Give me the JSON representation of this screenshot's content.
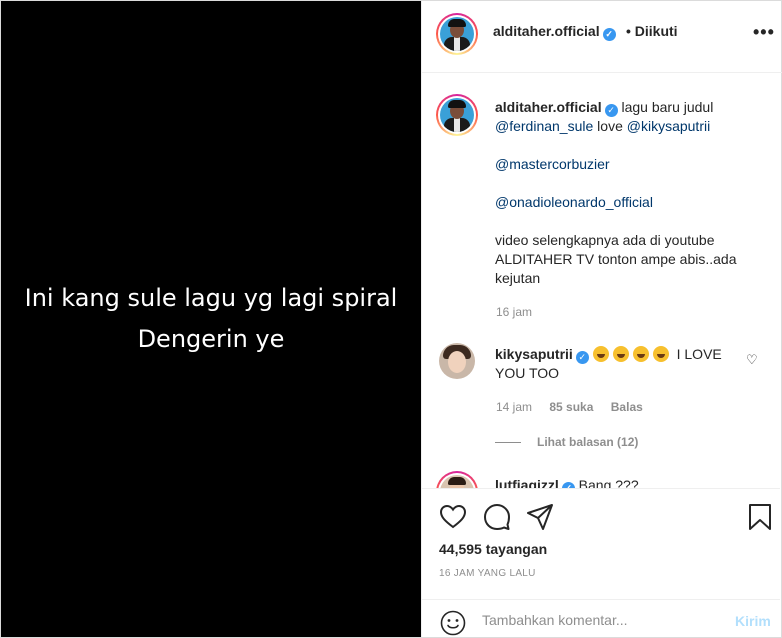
{
  "media": {
    "caption_lines": [
      "Ini kang sule lagu yg lagi spiral",
      "Dengerin ye"
    ]
  },
  "header": {
    "username": "alditaher.official",
    "follow_status": "• Diikuti",
    "more": "•••"
  },
  "caption": {
    "username": "alditaher.official",
    "text_line1": "lagu baru judul",
    "mention1": "@ferdinan_sule",
    "word_love": "love",
    "mention2": "@kikysaputrii",
    "mention3": "@mastercorbuzier",
    "mention4": "@onadioleonardo_official",
    "body": "video selengkapnya ada di youtube ALDITAHER TV tonton ampe abis..ada kejutan",
    "time": "16 jam"
  },
  "comments": [
    {
      "username": "kikysaputrii",
      "text_pre": "I",
      "text_post": "LOVE YOU TOO",
      "emoji_count": 4,
      "time": "14 jam",
      "likes": "85 suka",
      "reply": "Balas",
      "view_replies": "Lihat balasan (12)"
    },
    {
      "username": "lutfiagizzl",
      "text": "Bang ???"
    }
  ],
  "actions": {
    "views": "44,595 tayangan",
    "posted": "16 JAM YANG LALU"
  },
  "add_comment": {
    "placeholder": "Tambahkan komentar...",
    "send": "Kirim"
  },
  "colors": {
    "link": "#00376b",
    "verified": "#3897f0",
    "muted": "#8e8e8e",
    "send_disabled": "#b2dffc"
  }
}
